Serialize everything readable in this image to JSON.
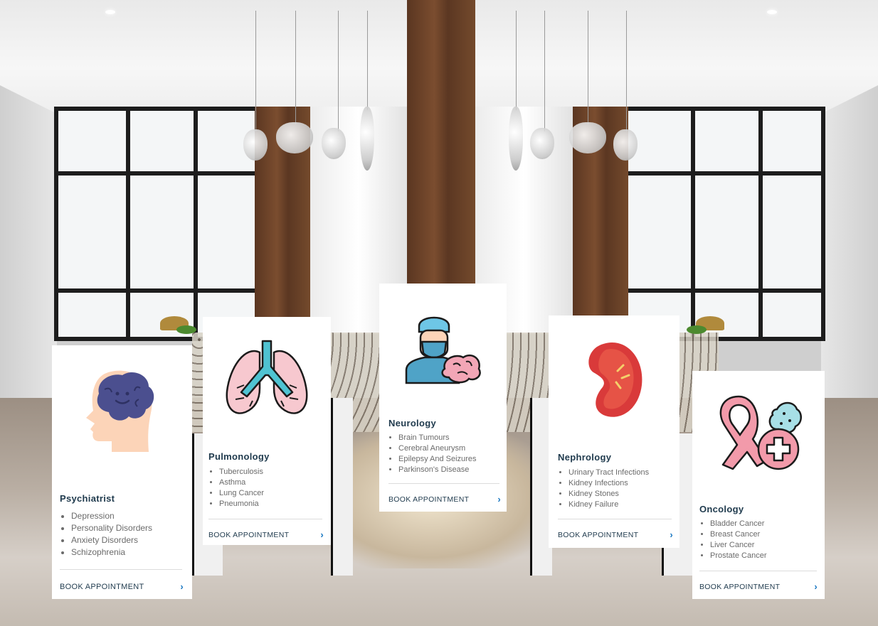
{
  "cards": [
    {
      "title": "Psychiatrist",
      "icon": "brain-head-icon",
      "items": [
        "Depression",
        "Personality Disorders",
        "Anxiety Disorders",
        "Schizophrenia"
      ],
      "cta": "BOOK APPOINTMENT"
    },
    {
      "title": "Pulmonology",
      "icon": "lungs-icon",
      "items": [
        "Tuberculosis",
        "Asthma",
        "Lung Cancer",
        "Pneumonia"
      ],
      "cta": "BOOK APPOINTMENT"
    },
    {
      "title": "Neurology",
      "icon": "neurosurgeon-icon",
      "items": [
        "Brain Tumours",
        "Cerebral Aneurysm",
        "Epilepsy And Seizures",
        "Parkinson's Disease"
      ],
      "cta": "BOOK APPOINTMENT"
    },
    {
      "title": "Nephrology",
      "icon": "kidney-icon",
      "items": [
        "Urinary Tract Infections",
        "Kidney Infections",
        "Kidney Stones",
        "Kidney Failure"
      ],
      "cta": "BOOK APPOINTMENT"
    },
    {
      "title": "Oncology",
      "icon": "cancer-ribbon-icon",
      "items": [
        "Bladder Cancer",
        "Breast Cancer",
        "Liver Cancer",
        "Prostate Cancer"
      ],
      "cta": "BOOK APPOINTMENT"
    }
  ],
  "colors": {
    "heading": "#1f3a4d",
    "chevron": "#1a78c2",
    "list_text": "#6b6b6b"
  }
}
